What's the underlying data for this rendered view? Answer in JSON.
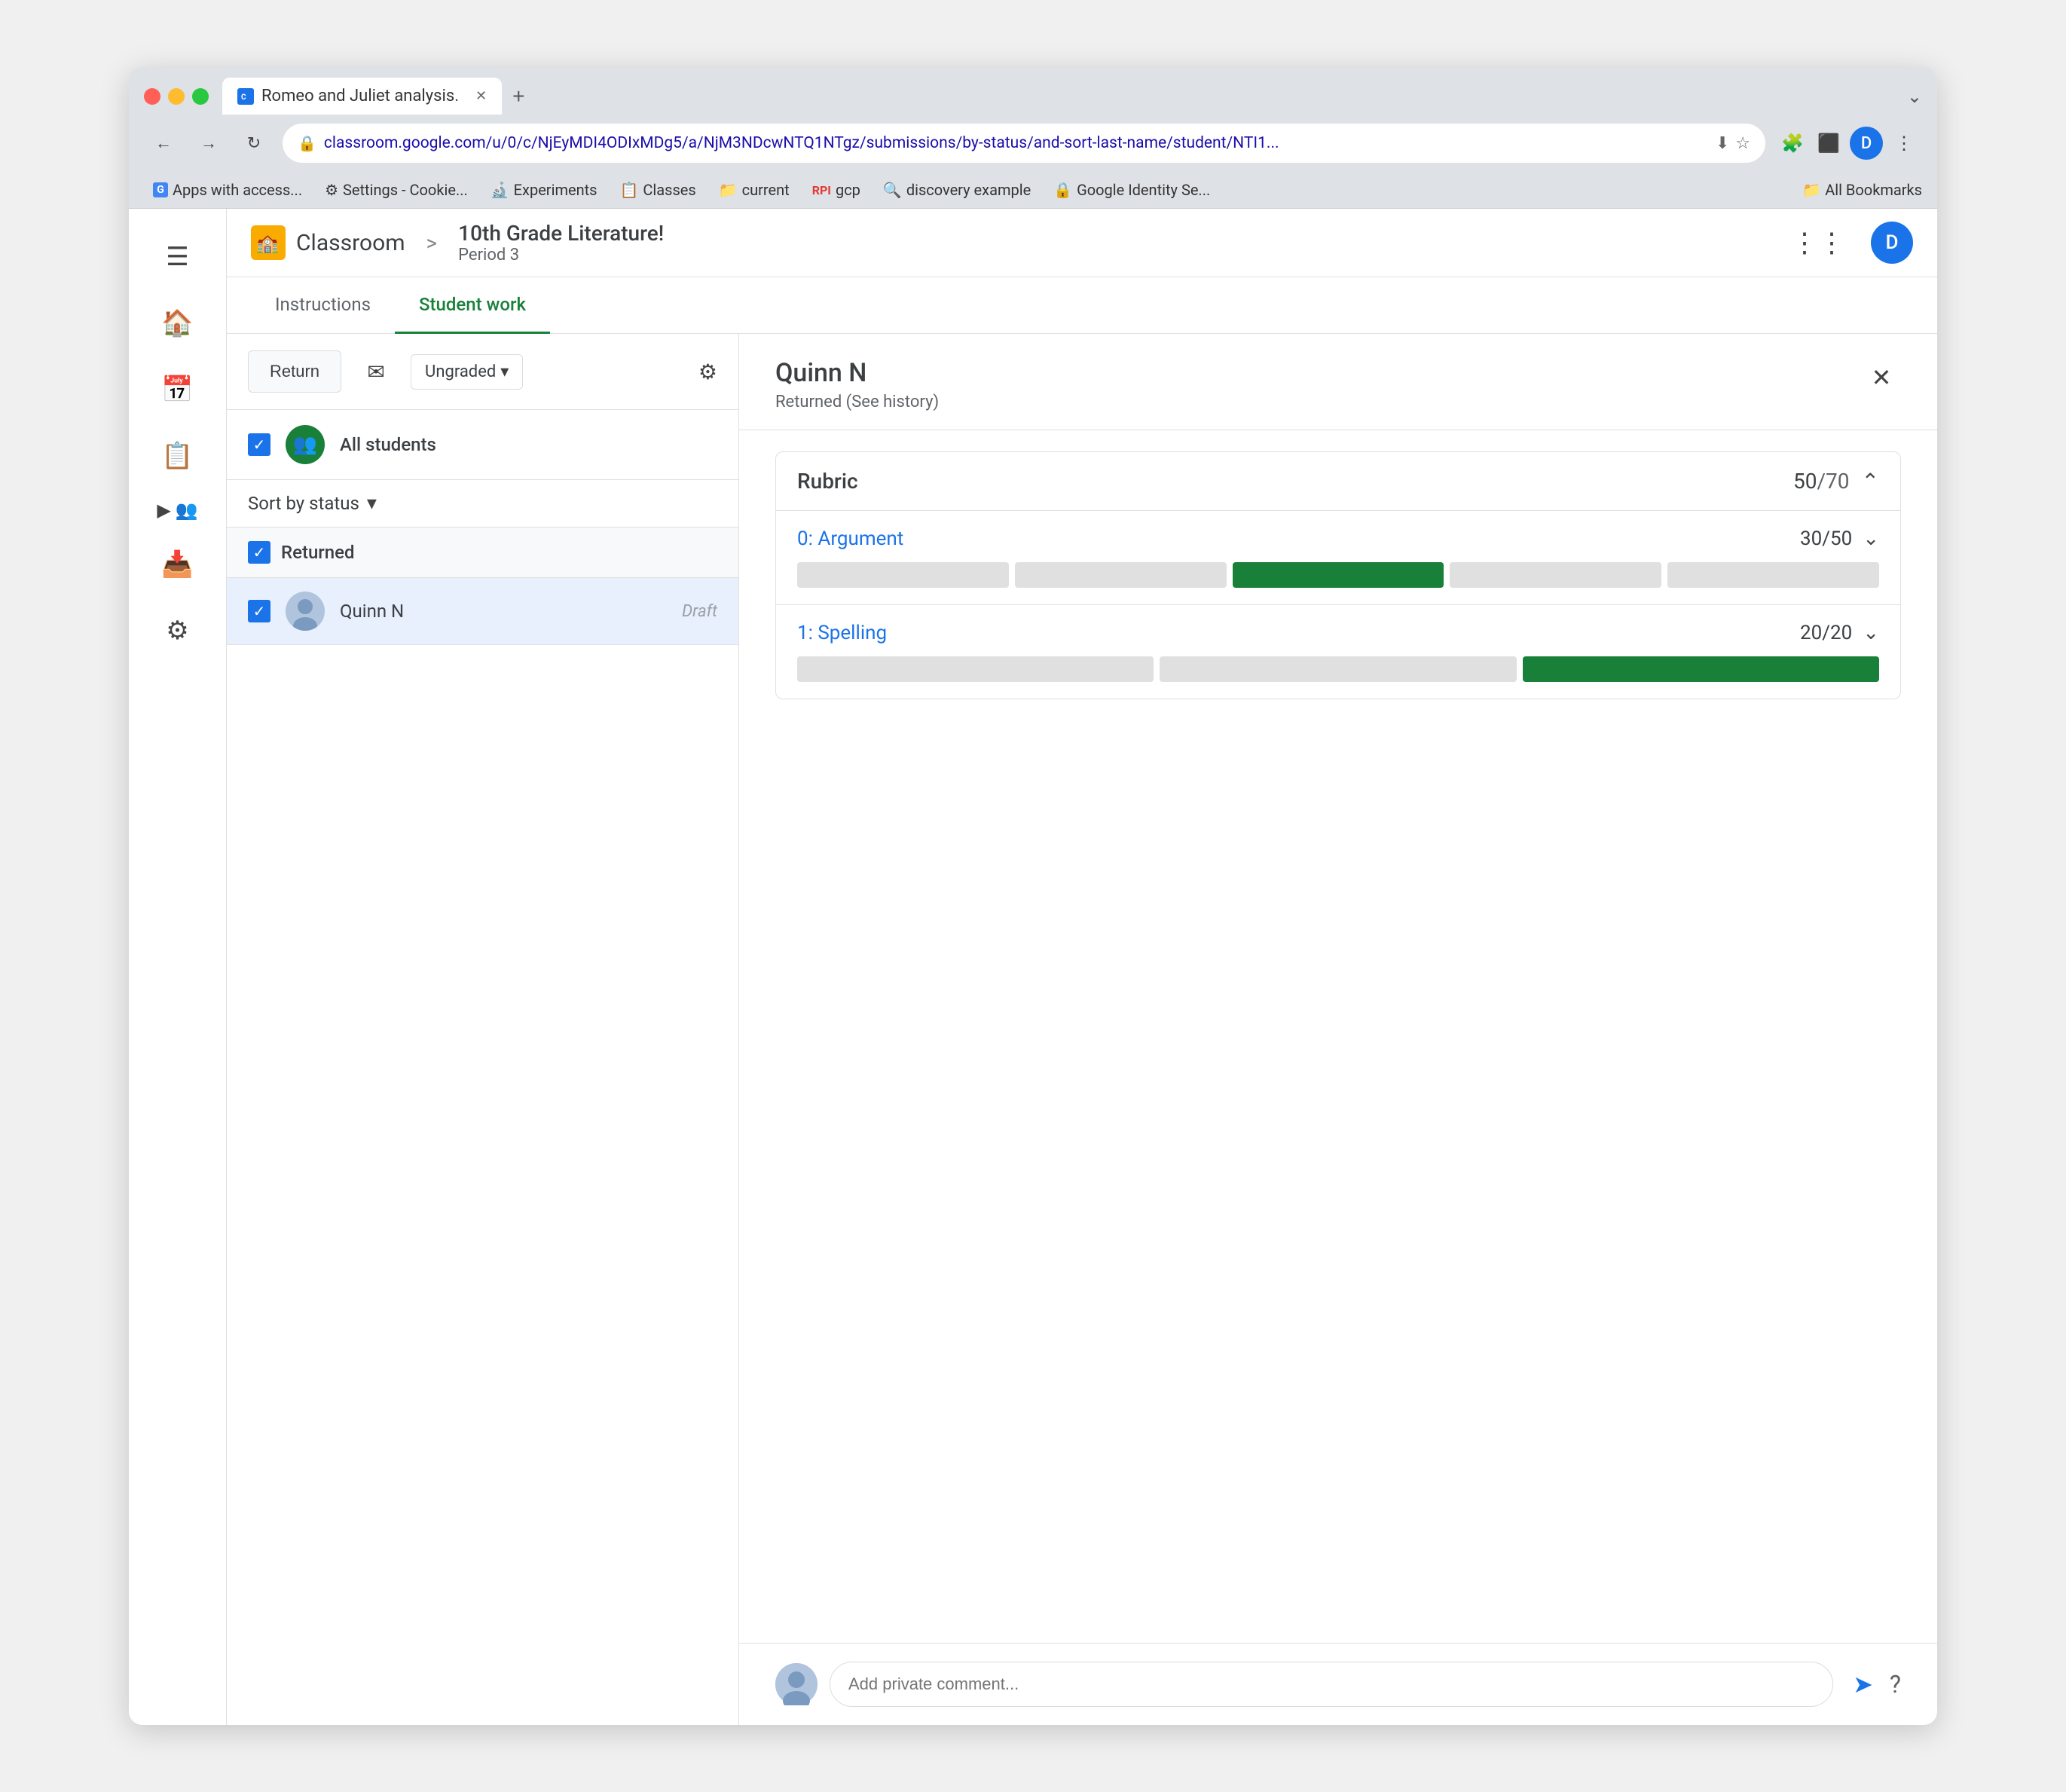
{
  "browser": {
    "tab_title": "Romeo and Juliet analysis.",
    "address": "classroom.google.com/u/0/c/NjEyMDI4ODIxMDg5/a/NjM3NDcwNTQ1NTgz/submissions/by-status/and-sort-last-name/student/NTI1...",
    "new_tab_label": "+",
    "profile_initial": "D",
    "traffic_lights": [
      "red",
      "yellow",
      "green"
    ],
    "bookmarks": [
      {
        "label": "Apps with access...",
        "icon": "G"
      },
      {
        "label": "Settings - Cookie...",
        "icon": "⚙"
      },
      {
        "label": "Experiments",
        "icon": "🔬"
      },
      {
        "label": "Classes",
        "icon": "📋"
      },
      {
        "label": "current",
        "icon": "📁"
      },
      {
        "label": "gcp",
        "icon": "RPI"
      },
      {
        "label": "discovery example",
        "icon": "🔍"
      },
      {
        "label": "Google Identity Se...",
        "icon": "🔒"
      }
    ],
    "bookmarks_end": "All Bookmarks"
  },
  "app": {
    "menu_icon": "☰",
    "logo_text": "Classroom",
    "breadcrumb_sep": ">",
    "course_title": "10th Grade Literature!",
    "course_period": "Period 3",
    "apps_icon": "⋮⋮⋮",
    "profile_initial": "D",
    "tabs": [
      {
        "label": "Instructions",
        "active": false
      },
      {
        "label": "Student work",
        "active": true
      }
    ]
  },
  "toolbar": {
    "return_label": "Return",
    "email_icon": "✉",
    "grade_label": "Ungraded",
    "settings_icon": "⚙"
  },
  "student_list": {
    "all_students_label": "All students",
    "sort_label": "Sort by status",
    "sections": [
      {
        "title": "Returned",
        "students": [
          {
            "name": "Quinn N",
            "status": "Draft",
            "selected": true
          }
        ]
      }
    ]
  },
  "student_detail": {
    "name": "Quinn N",
    "status": "Returned (See history)",
    "close_icon": "✕",
    "rubric": {
      "title": "Rubric",
      "score": "50",
      "total": "70",
      "items": [
        {
          "name": "0: Argument",
          "score": "30",
          "total": "50",
          "segments": 5,
          "selected_segment": 2
        },
        {
          "name": "1: Spelling",
          "score": "20",
          "total": "20",
          "segments": 3,
          "selected_segment": 2
        }
      ]
    },
    "comment_placeholder": "Add private comment...",
    "send_icon": "➤",
    "help_icon": "?"
  },
  "nav_icons": {
    "home": "🏠",
    "calendar": "📅",
    "assignment": "📋",
    "people": "👥",
    "inbox": "📥",
    "settings": "⚙"
  },
  "icons": {
    "back": "←",
    "forward": "→",
    "refresh": "↻",
    "lock": "🔒",
    "star": "☆",
    "extensions": "🧩",
    "sidebar_toggle": "⬛",
    "more": "⋮",
    "down_arrow": "▾",
    "expand_up": "⌃",
    "expand_down": "⌄",
    "check": "✓"
  }
}
